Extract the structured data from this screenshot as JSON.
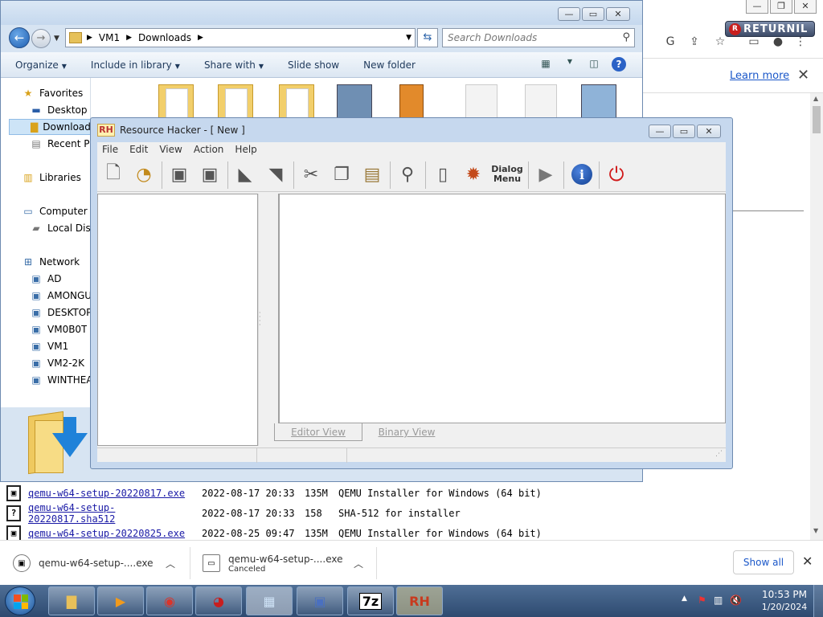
{
  "browser": {
    "infobar": {
      "learn_more": "Learn more",
      "close": "✕"
    },
    "returnil": "RETURNIL",
    "listing": [
      {
        "icon": "exe",
        "name": "qemu-w64-setup-20220817.exe",
        "date": "2022-08-17 20:33",
        "size": "135M",
        "desc": "QEMU Installer for Windows (64 bit)"
      },
      {
        "icon": "unknown",
        "name": "qemu-w64-setup-20220817.sha512",
        "date": "2022-08-17 20:33",
        "size": "158",
        "desc": "SHA-512 for installer"
      },
      {
        "icon": "exe",
        "name": "qemu-w64-setup-20220825.exe",
        "date": "2022-08-25 09:47",
        "size": "135M",
        "desc": "QEMU Installer for Windows (64 bit)"
      }
    ],
    "downloads_bar": {
      "items": [
        {
          "name": "qemu-w64-setup-....exe",
          "status": ""
        },
        {
          "name": "qemu-w64-setup-....exe",
          "status": "Canceled"
        }
      ],
      "show_all": "Show all"
    }
  },
  "explorer": {
    "address": [
      "VM1",
      "Downloads"
    ],
    "search_placeholder": "Search Downloads",
    "commands": [
      "Organize",
      "Include in library",
      "Share with",
      "Slide show",
      "New folder"
    ],
    "nav": {
      "favorites": "Favorites",
      "desktop": "Desktop",
      "downloads": "Downloads",
      "recent": "Recent Places",
      "libraries": "Libraries",
      "computer": "Computer",
      "local_disk": "Local Disk",
      "network": "Network",
      "hosts": [
        "AD",
        "AMONGUS",
        "DESKTOP-",
        "VM0B0T",
        "VM1",
        "VM2-2K",
        "WINTHEATER"
      ]
    }
  },
  "rh": {
    "title": "Resource Hacker - [ New ]",
    "logo": "RH",
    "menus": [
      "File",
      "Edit",
      "View",
      "Action",
      "Help"
    ],
    "toolbar_dialog_label": "Dialog Menu",
    "tabs": {
      "editor": "Editor View",
      "binary": "Binary View"
    }
  },
  "taskbar": {
    "clock_time": "10:53 PM",
    "clock_date": "1/20/2024",
    "apps": [
      "explorer",
      "media-player",
      "chrome",
      "returnil",
      "control-panel",
      "vs",
      "7z",
      "rh"
    ],
    "seven_zip_label": "7z",
    "rh_label": "RH"
  }
}
